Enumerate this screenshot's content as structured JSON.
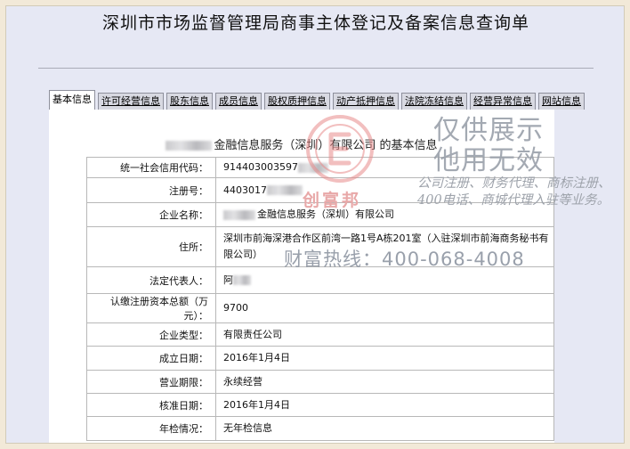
{
  "page": {
    "title": "深圳市市场监督管理局商事主体登记及备案信息查询单"
  },
  "tabs": [
    {
      "label": "基本信息",
      "active": true
    },
    {
      "label": "许可经营信息",
      "active": false
    },
    {
      "label": "股东信息",
      "active": false
    },
    {
      "label": "成员信息",
      "active": false
    },
    {
      "label": "股权质押信息",
      "active": false
    },
    {
      "label": "动产抵押信息",
      "active": false
    },
    {
      "label": "法院冻结信息",
      "active": false
    },
    {
      "label": "经营异常信息",
      "active": false
    },
    {
      "label": "网站信息",
      "active": false
    }
  ],
  "company": {
    "heading": "金融信息服务（深圳）有限公司 的基本信息"
  },
  "fields": [
    {
      "label": "统一社会信用代码：",
      "value": "914403003597"
    },
    {
      "label": "注册号：",
      "value": "4403017"
    },
    {
      "label": "企业名称：",
      "value": "金融信息服务（深圳）有限公司"
    },
    {
      "label": "住所：",
      "value": "深圳市前海深港合作区前湾一路1号A栋201室（入驻深圳市前海商务秘书有限公司）"
    },
    {
      "label": "法定代表人：",
      "value": "阿"
    },
    {
      "label": "认缴注册资本总额（万元）：",
      "value": "9700"
    },
    {
      "label": "企业类型：",
      "value": "有限责任公司"
    },
    {
      "label": "成立日期：",
      "value": "2016年1月4日"
    },
    {
      "label": "营业期限：",
      "value": "永续经营"
    },
    {
      "label": "核准日期：",
      "value": "2016年1月4日"
    },
    {
      "label": "年检情况：",
      "value": "无年检信息"
    }
  ],
  "watermark": {
    "brand": "创富邦",
    "line1": "仅供展示",
    "line2": "他用无效",
    "services": "公司注册、财务代理、商标注册、400电话、商城代理入驻等业务。",
    "hotline": "财富热线：400-068-4008",
    "color": "#e88b8b"
  }
}
